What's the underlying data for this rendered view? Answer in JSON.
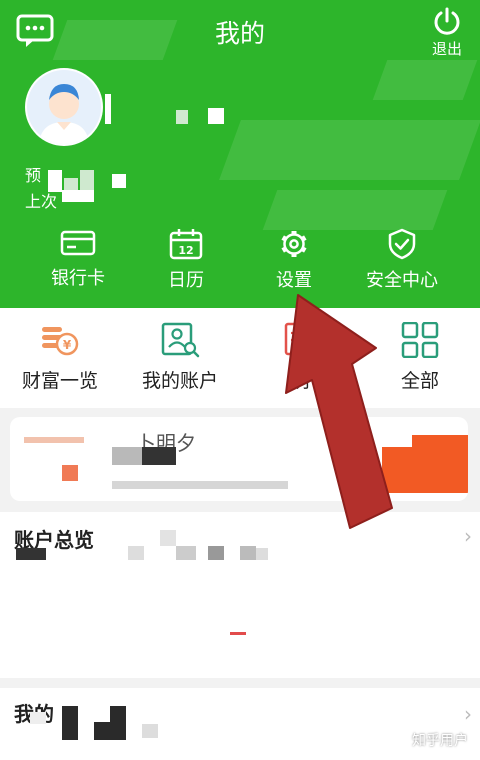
{
  "header": {
    "title": "我的",
    "logout_label": "退出",
    "subtitle_line1": "预",
    "subtitle_line2": "上次",
    "brand_color": "#2db52b"
  },
  "quick_actions": [
    {
      "label": "银行卡",
      "icon": "bank-card-icon"
    },
    {
      "label": "日历",
      "icon": "calendar-icon",
      "day": "12"
    },
    {
      "label": "设置",
      "icon": "gear-icon"
    },
    {
      "label": "安全中心",
      "icon": "shield-check-icon"
    }
  ],
  "services": [
    {
      "label": "财富一览",
      "icon": "coins-icon"
    },
    {
      "label": "我的账户",
      "icon": "account-card-icon"
    },
    {
      "label": "明",
      "icon": "document-icon"
    },
    {
      "label": "全部",
      "icon": "grid-icon"
    }
  ],
  "sections": {
    "card_title": "卜明夕",
    "overview_title": "账户总览",
    "bottom_title": "我的"
  },
  "watermark": "知乎用户",
  "annotation_color": "#b3302c"
}
